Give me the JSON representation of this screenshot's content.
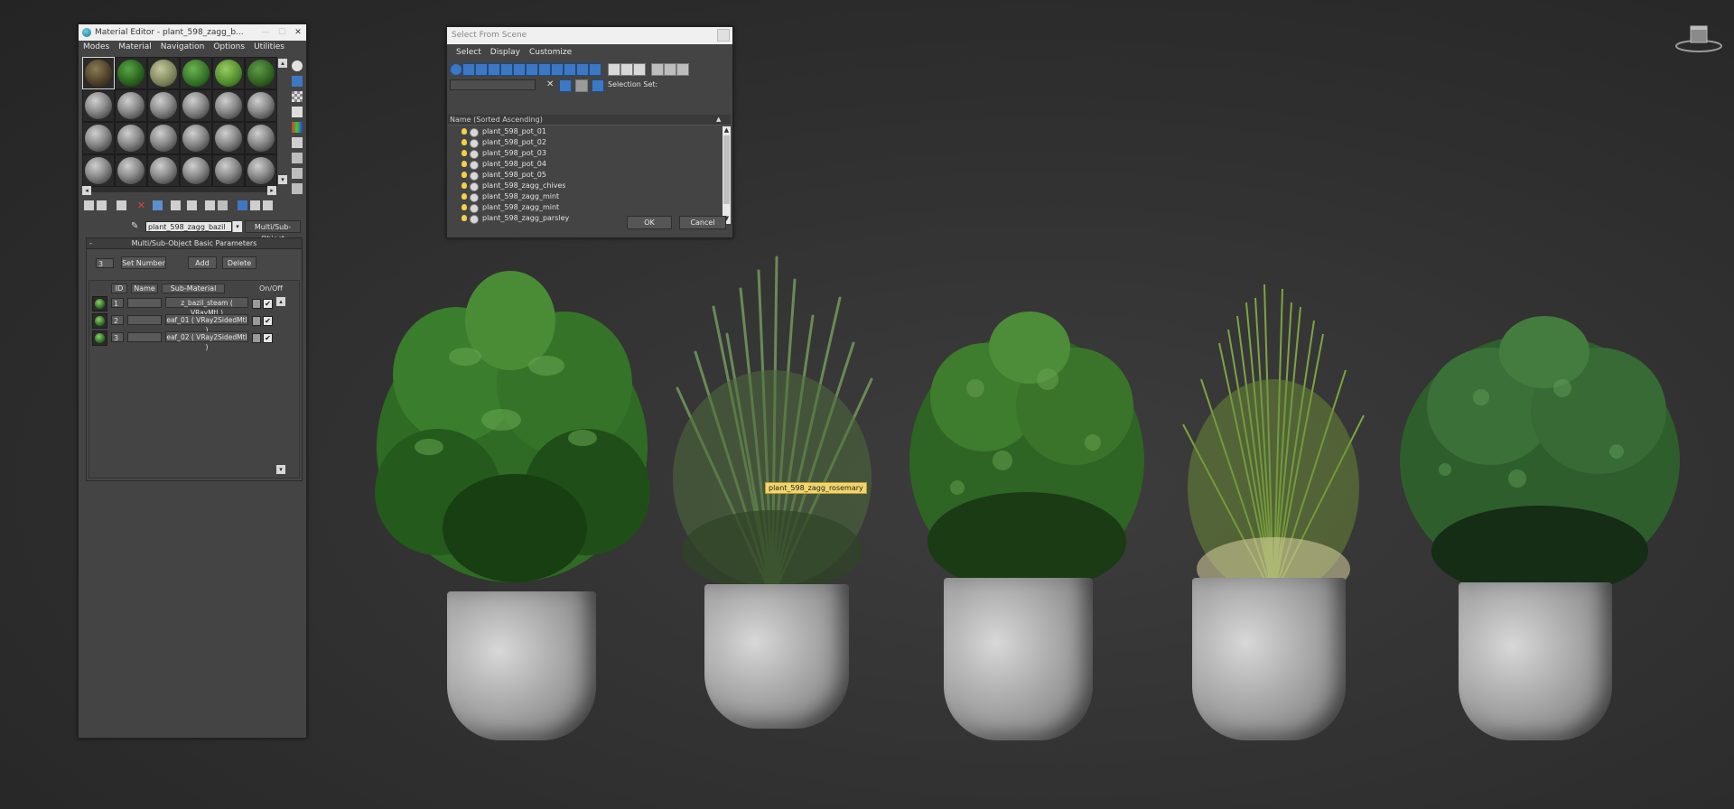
{
  "viewport": {
    "tooltip": "plant_598_zagg_rosemary",
    "plants": [
      {
        "name": "basil",
        "leaf": "#2f6b25",
        "leaf_dark": "#12300d"
      },
      {
        "name": "rosemary",
        "leaf": "#5b7c46",
        "leaf_dark": "#2e4226"
      },
      {
        "name": "parsley",
        "leaf": "#3d7a2c",
        "leaf_dark": "#173612"
      },
      {
        "name": "chives",
        "leaf": "#8cb04a",
        "leaf_dark": "#3f5d1e"
      },
      {
        "name": "mint",
        "leaf": "#39693a",
        "leaf_dark": "#152c15"
      }
    ]
  },
  "material_editor": {
    "title": "Material Editor - plant_598_zagg_b...",
    "menu": [
      "Modes",
      "Material",
      "Navigation",
      "Options",
      "Utilities"
    ],
    "material_name": "plant_598_zagg_bazil",
    "material_type": "Multi/Sub-Object",
    "rollout_title": "Multi/Sub-Object Basic Parameters",
    "count_value": "3",
    "set_number": "Set Number",
    "add": "Add",
    "delete": "Delete",
    "columns": {
      "id": "ID",
      "name": "Name",
      "sub_material": "Sub-Material",
      "on_off": "On/Off"
    },
    "rows": [
      {
        "id": "1",
        "name": "",
        "sub": "z_bazil_steam  ( VRayMtl )",
        "on": "✔"
      },
      {
        "id": "2",
        "name": "",
        "sub": "eaf_01  ( VRay2SidedMtl )",
        "on": "✔"
      },
      {
        "id": "3",
        "name": "",
        "sub": "eaf_02  ( VRay2SidedMtl )",
        "on": "✔"
      }
    ]
  },
  "select_from_scene": {
    "title": "Select From Scene",
    "menu": [
      "Select",
      "Display",
      "Customize"
    ],
    "selection_set_label": "Selection Set:",
    "column_header": "Name (Sorted Ascending)",
    "items": [
      "plant_598_pot_01",
      "plant_598_pot_02",
      "plant_598_pot_03",
      "plant_598_pot_04",
      "plant_598_pot_05",
      "plant_598_zagg_chives",
      "plant_598_zagg_mint",
      "plant_598_zagg_mint",
      "plant_598_zagg_parsley"
    ],
    "ok": "OK",
    "cancel": "Cancel"
  }
}
